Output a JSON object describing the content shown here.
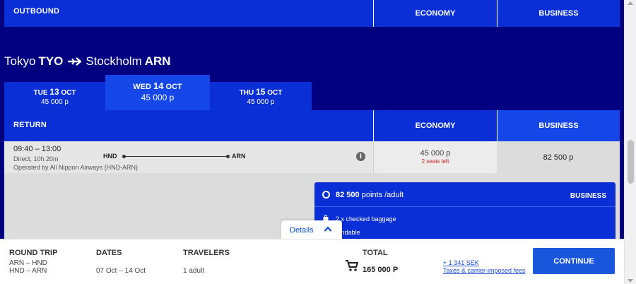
{
  "outbound_bar": {
    "label": "OUTBOUND",
    "economy_label": "ECONOMY",
    "business_label": "BUSINESS"
  },
  "route": {
    "origin_city": "Tokyo",
    "origin_code": "TYO",
    "destination_city": "Stockholm",
    "destination_code": "ARN"
  },
  "date_tabs": [
    {
      "day": "TUE",
      "date_num": "13",
      "month": "OCT",
      "price": "45 000 p",
      "selected": false
    },
    {
      "day": "WED",
      "date_num": "14",
      "month": "OCT",
      "price": "45 000 p",
      "selected": true
    },
    {
      "day": "THU",
      "date_num": "15",
      "month": "OCT",
      "price": "45 000 p",
      "selected": false
    }
  ],
  "return_bar": {
    "label": "RETURN",
    "economy_label": "ECONOMY",
    "business_label": "BUSINESS"
  },
  "flight": {
    "times": "09:40 – 13:00",
    "duration": "Direct, 10h 20m",
    "operator": "Operated by All Nippon Airways (HND-ARN)",
    "from_code": "HND",
    "to_code": "ARN",
    "info_glyph": "i",
    "economy_price": "45 000 p",
    "economy_seats": "2 seats left",
    "business_price": "82 500 p"
  },
  "business_panel": {
    "points": "82 500",
    "points_suffix": "points /adult",
    "class_label": "BUSINESS",
    "feature_baggage": "2 x checked baggage",
    "feature_refund": "fundable"
  },
  "details_tab": {
    "label": "Details"
  },
  "footer": {
    "trip_head": "ROUND TRIP",
    "trip_line1": "ARN – HND",
    "trip_line2": "HND – ARN",
    "dates_head": "DATES",
    "dates_val": "07 Oct – 14 Oct",
    "travelers_head": "TRAVELERS",
    "travelers_val": "1 adult",
    "total_head": "TOTAL",
    "total_val": "165 000 P",
    "fee_amount": "+ 1 341 SEK",
    "fee_label": "Taxes & carrier-imposed fees",
    "continue_label": "CONTINUE"
  },
  "colors": {
    "page_bg": "#000080",
    "bar_blue": "#0b2fd6",
    "selected_tab": "#1546e8",
    "seats_warning": "#d02020",
    "link": "#1a4fd6",
    "continue_btn": "#1a56dc"
  }
}
